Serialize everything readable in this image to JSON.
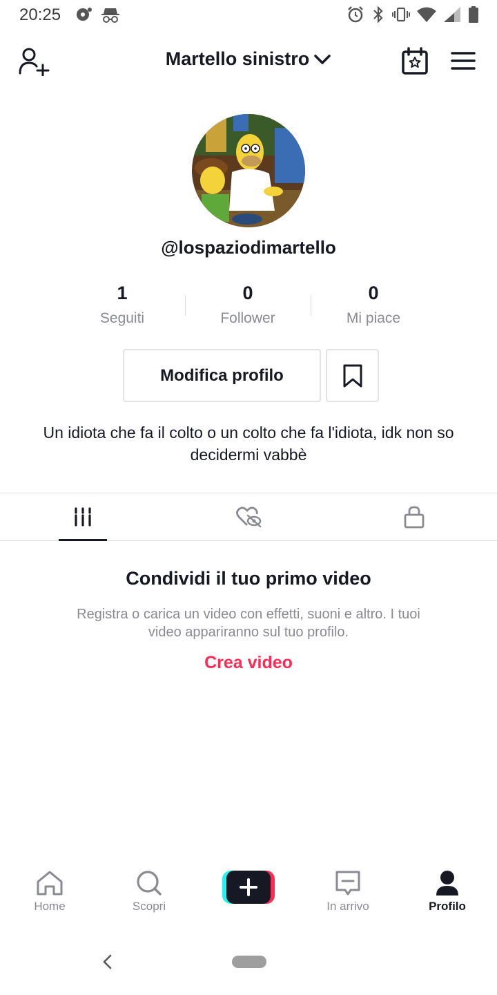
{
  "status_bar": {
    "time": "20:25"
  },
  "header": {
    "account_name": "Martello sinistro",
    "icons": [
      "add-user-icon",
      "chevron-down-icon",
      "calendar-star-icon",
      "menu-icon"
    ]
  },
  "profile": {
    "username": "@lospaziodimartello",
    "stats": [
      {
        "value": "1",
        "label": "Seguiti"
      },
      {
        "value": "0",
        "label": "Follower"
      },
      {
        "value": "0",
        "label": "Mi piace"
      }
    ],
    "edit_button_label": "Modifica profilo",
    "bio": "Un idiota che fa il colto o un colto che fa l'idiota, idk non so decidermi vabbè"
  },
  "tabs": [
    {
      "name": "videos",
      "icon": "grid-icon",
      "active": true
    },
    {
      "name": "liked",
      "icon": "heart-hidden-icon",
      "active": false
    },
    {
      "name": "private",
      "icon": "lock-icon",
      "active": false
    }
  ],
  "empty_state": {
    "title": "Condividi il tuo primo video",
    "description": "Registra o carica un video con effetti, suoni e altro. I tuoi video appariranno sul tuo profilo.",
    "action_label": "Crea video"
  },
  "bottom_nav": {
    "items": [
      {
        "label": "Home",
        "icon": "home-icon",
        "active": false
      },
      {
        "label": "Scopri",
        "icon": "search-icon",
        "active": false
      },
      {
        "label": "In arrivo",
        "icon": "inbox-icon",
        "active": false
      },
      {
        "label": "Profilo",
        "icon": "profile-icon",
        "active": true
      }
    ]
  },
  "colors": {
    "accent": "#fe2c55",
    "text": "#161823",
    "muted": "#8a8b91",
    "border": "#e3e3e4"
  }
}
